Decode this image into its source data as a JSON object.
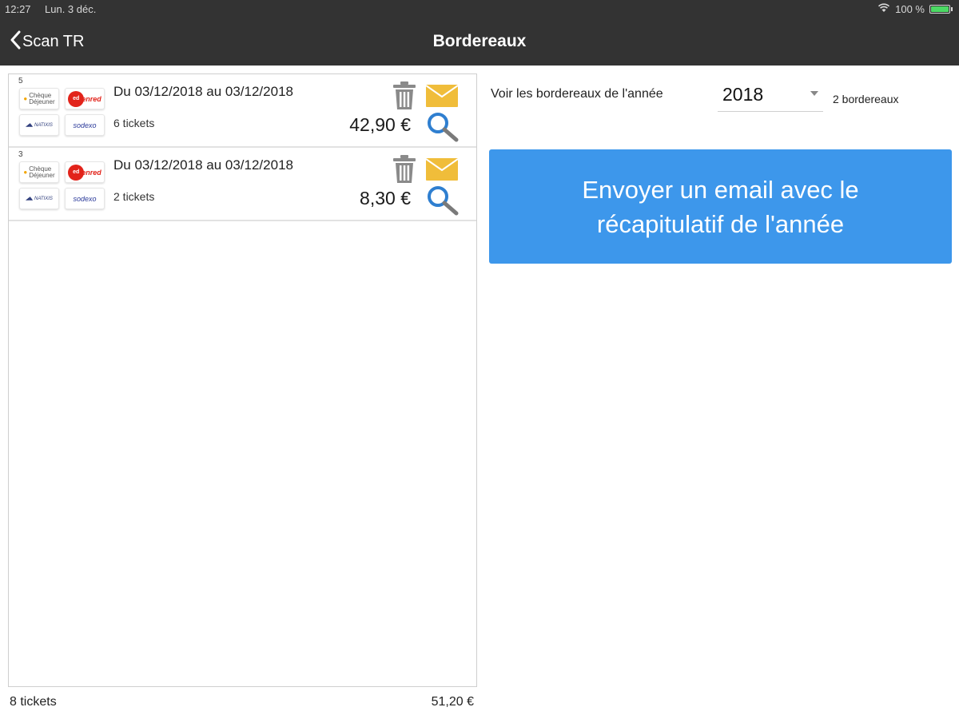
{
  "status_bar": {
    "time": "12:27",
    "date": "Lun. 3 déc.",
    "battery": "100 %"
  },
  "nav": {
    "back_label": "Scan TR",
    "title": "Bordereaux"
  },
  "bordereaux": [
    {
      "index": "5",
      "period": "Du 03/12/2018 au 03/12/2018",
      "tickets": "6 tickets",
      "amount": "42,90 €",
      "logos": [
        "Chèque Déjeuner",
        "Edenred",
        "Natixis",
        "Sodexo"
      ]
    },
    {
      "index": "3",
      "period": "Du 03/12/2018 au 03/12/2018",
      "tickets": "2 tickets",
      "amount": "8,30 €",
      "logos": [
        "Chèque Déjeuner",
        "Edenred",
        "Natixis",
        "Sodexo"
      ]
    }
  ],
  "footer": {
    "total_tickets": "8 tickets",
    "total_amount": "51,20 €"
  },
  "year_filter": {
    "label": "Voir les bordereaux de l'année",
    "selected": "2018",
    "count": "2 bordereaux"
  },
  "email_button": {
    "label": "Envoyer un email avec le récapitulatif de l'année"
  },
  "colors": {
    "nav_bg": "#333333",
    "button_blue": "#3d97eb",
    "mail_yellow": "#f0bd3a",
    "search_blue": "#2f7fd0",
    "battery_green": "#4cd964"
  },
  "icons": [
    "chevron-left-icon",
    "wifi-icon",
    "battery-icon",
    "trash-icon",
    "mail-icon",
    "search-icon",
    "dropdown-caret-icon"
  ]
}
